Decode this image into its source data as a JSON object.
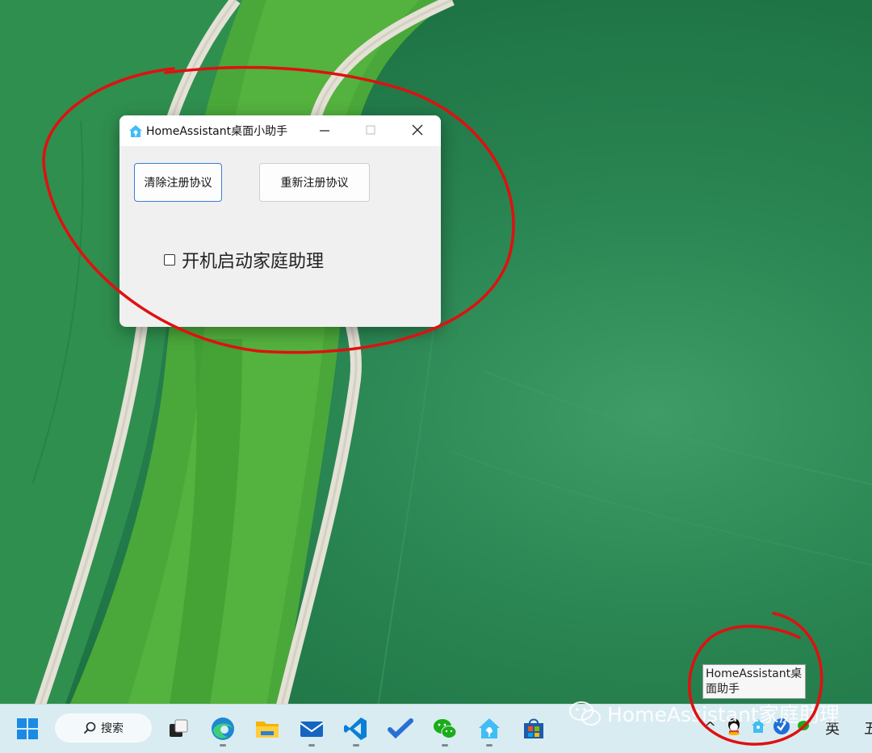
{
  "window": {
    "title": "HomeAssistant桌面小助手",
    "buttons": {
      "clear": "清除注册协议",
      "re_register": "重新注册协议"
    },
    "checkbox": {
      "label": "开机启动家庭助理",
      "checked": false
    },
    "controls": {
      "minimize_icon": "minimize-icon",
      "maximize_icon": "maximize-icon",
      "close_icon": "close-icon"
    }
  },
  "tooltip": {
    "line1": "HomeAssistant桌",
    "line2": "面助手"
  },
  "watermark": {
    "text": "HomeAssistant家庭助理"
  },
  "taskbar": {
    "search_label": "搜索",
    "apps": [
      "start-icon",
      "task-view-icon",
      "edge-icon",
      "file-explorer-icon",
      "mail-icon",
      "vscode-icon",
      "todo-icon",
      "wechat-icon",
      "homeassistant-icon",
      "store-icon"
    ],
    "tray": {
      "chevron": "^",
      "lang": "英",
      "ime": "五"
    }
  },
  "colors": {
    "accent_blue": "#3a7fd6",
    "annotation_red": "#e01010",
    "taskbar_bg": "#d9ecf1"
  }
}
